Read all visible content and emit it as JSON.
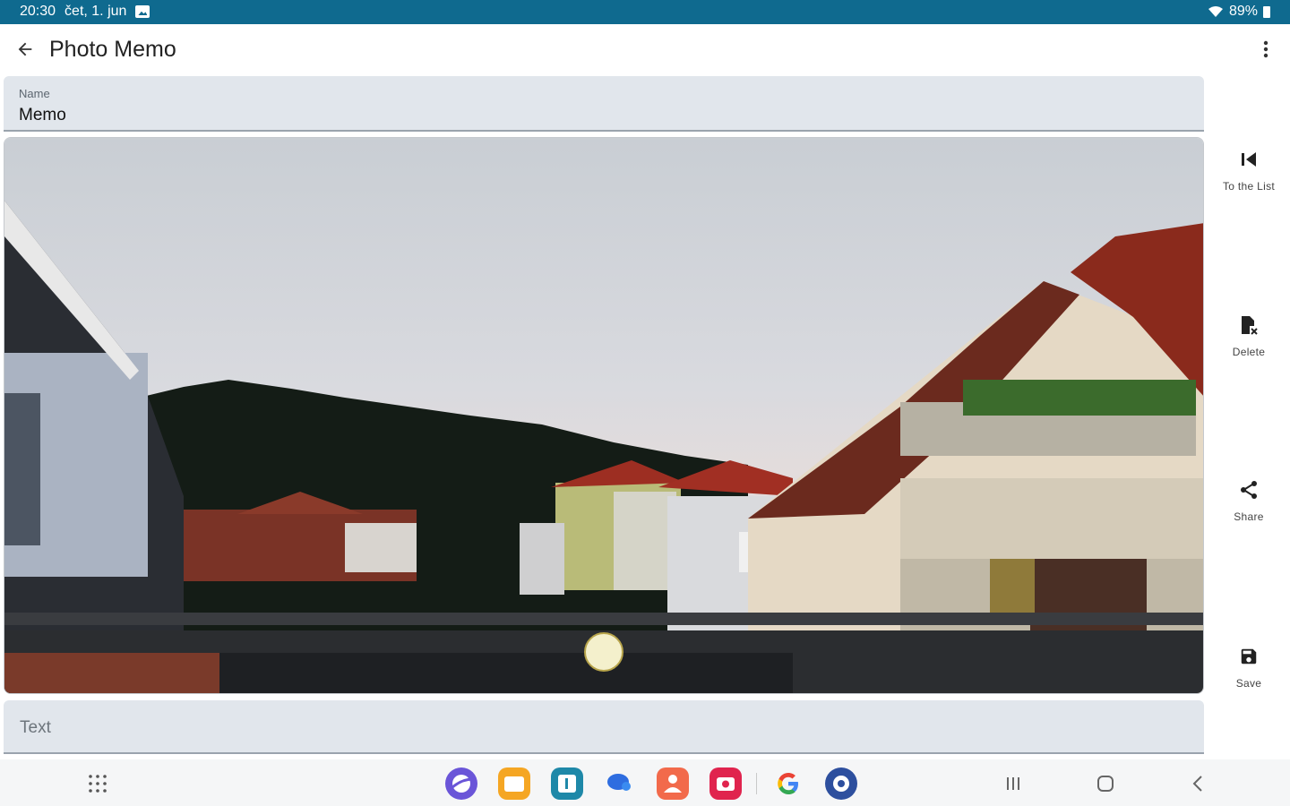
{
  "status_bar": {
    "time": "20:30",
    "date": "čet, 1. jun",
    "battery": "89%"
  },
  "app_bar": {
    "title": "Photo Memo"
  },
  "name_field": {
    "label": "Name",
    "value": "Memo"
  },
  "text_field": {
    "placeholder": "Text"
  },
  "side_actions": [
    {
      "label": "To the List",
      "icon": "arrow-to-list-icon"
    },
    {
      "label": "Delete",
      "icon": "delete-icon"
    },
    {
      "label": "Share",
      "icon": "share-icon"
    },
    {
      "label": "Save",
      "icon": "save-icon"
    }
  ],
  "dock_apps": [
    "internet-icon",
    "my-files-icon",
    "calendar-icon",
    "messages-icon",
    "contacts-icon",
    "camera-icon",
    "google-icon",
    "settings-icon"
  ],
  "colors": {
    "status_bar": "#0f6a8f",
    "field_bg": "#e1e6ec",
    "navbar_bg": "#f5f6f7"
  }
}
